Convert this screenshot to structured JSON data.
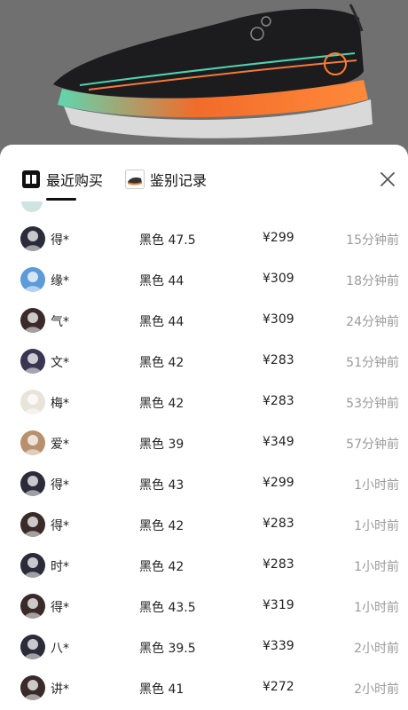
{
  "tabs": [
    {
      "label": "最近购买",
      "icon": "receipt-badge-icon",
      "selected": true
    },
    {
      "label": "鉴别记录",
      "icon": "shoe-thumbnail-icon",
      "selected": false
    }
  ],
  "close_icon": "close-icon",
  "records": [
    {
      "name": "得*",
      "spec": "黑色 47.5",
      "price": "¥299",
      "time": "15分钟前",
      "avatar_color": "#2b2b3a"
    },
    {
      "name": "缘*",
      "spec": "黑色 44",
      "price": "¥309",
      "time": "18分钟前",
      "avatar_color": "#5a9bd8"
    },
    {
      "name": "气*",
      "spec": "黑色 44",
      "price": "¥309",
      "time": "24分钟前",
      "avatar_color": "#3a2a2a"
    },
    {
      "name": "文*",
      "spec": "黑色 42",
      "price": "¥283",
      "time": "51分钟前",
      "avatar_color": "#3a3550"
    },
    {
      "name": "梅*",
      "spec": "黑色 42",
      "price": "¥283",
      "time": "53分钟前",
      "avatar_color": "#e9e4da"
    },
    {
      "name": "爱*",
      "spec": "黑色 39",
      "price": "¥349",
      "time": "57分钟前",
      "avatar_color": "#b9906e"
    },
    {
      "name": "得*",
      "spec": "黑色 43",
      "price": "¥299",
      "time": "1小时前",
      "avatar_color": "#2b2b3a"
    },
    {
      "name": "得*",
      "spec": "黑色 42",
      "price": "¥283",
      "time": "1小时前",
      "avatar_color": "#3a2a2a"
    },
    {
      "name": "时*",
      "spec": "黑色 42",
      "price": "¥283",
      "time": "1小时前",
      "avatar_color": "#2b2b3a"
    },
    {
      "name": "得*",
      "spec": "黑色 43.5",
      "price": "¥319",
      "time": "1小时前",
      "avatar_color": "#3a2a2a"
    },
    {
      "name": "八*",
      "spec": "黑色 39.5",
      "price": "¥339",
      "time": "2小时前",
      "avatar_color": "#2b2b3a"
    },
    {
      "name": "讲*",
      "spec": "黑色 41",
      "price": "¥272",
      "time": "2小时前",
      "avatar_color": "#3a2a2a"
    }
  ]
}
